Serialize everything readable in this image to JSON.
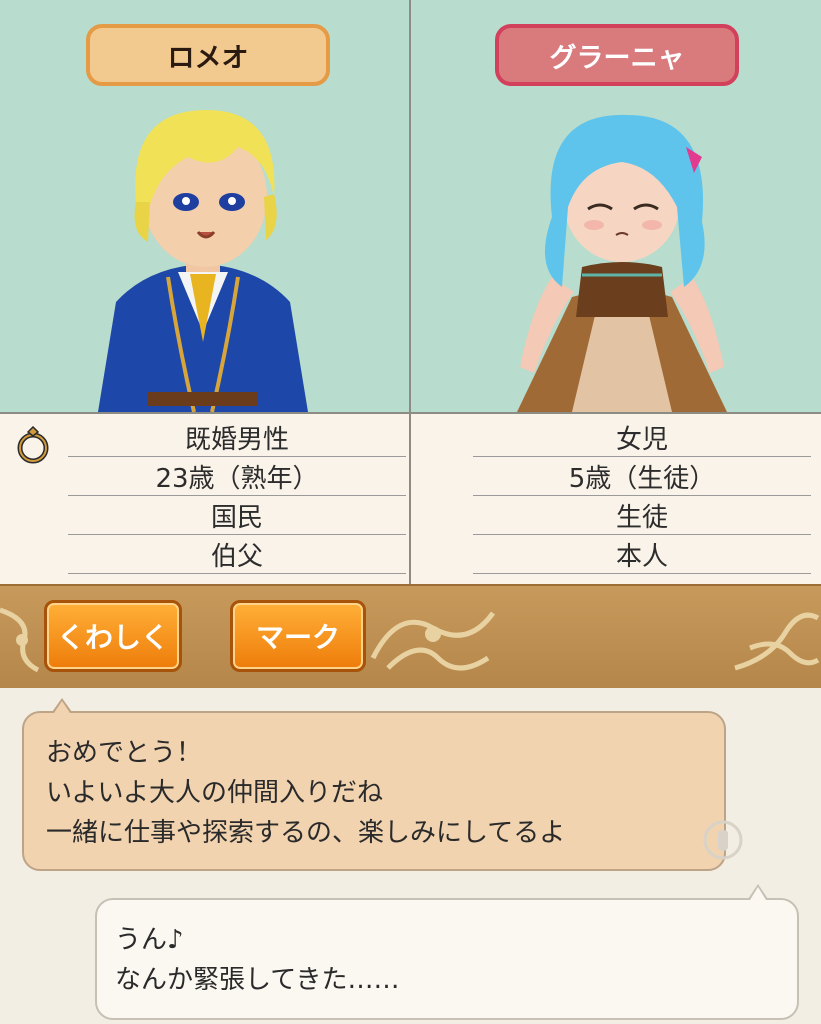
{
  "characters": {
    "left": {
      "name": "ロメオ",
      "profile": [
        "既婚男性",
        "23歳（熟年）",
        "国民",
        "伯父"
      ]
    },
    "right": {
      "name": "グラーニャ",
      "profile": [
        "女児",
        "5歳（生徒）",
        "生徒",
        "本人"
      ]
    }
  },
  "toolbar": {
    "detail_label": "くわしく",
    "mark_label": "マーク"
  },
  "dialogue": {
    "first": [
      "おめでとう！",
      "いよいよ大人の仲間入りだね",
      "一緒に仕事や探索するの、楽しみにしてるよ"
    ],
    "second": [
      "うん♪",
      "なんか緊張してきた……"
    ]
  },
  "colors": {
    "portrait_bg": "#b8dccd",
    "left_name_plate": "#f2c98e",
    "right_name_plate": "#d97a7d",
    "button_orange": "#f39422",
    "toolbar_brown": "#c29356"
  },
  "icons": {
    "married": "ring-icon",
    "advance": "tap-icon"
  }
}
